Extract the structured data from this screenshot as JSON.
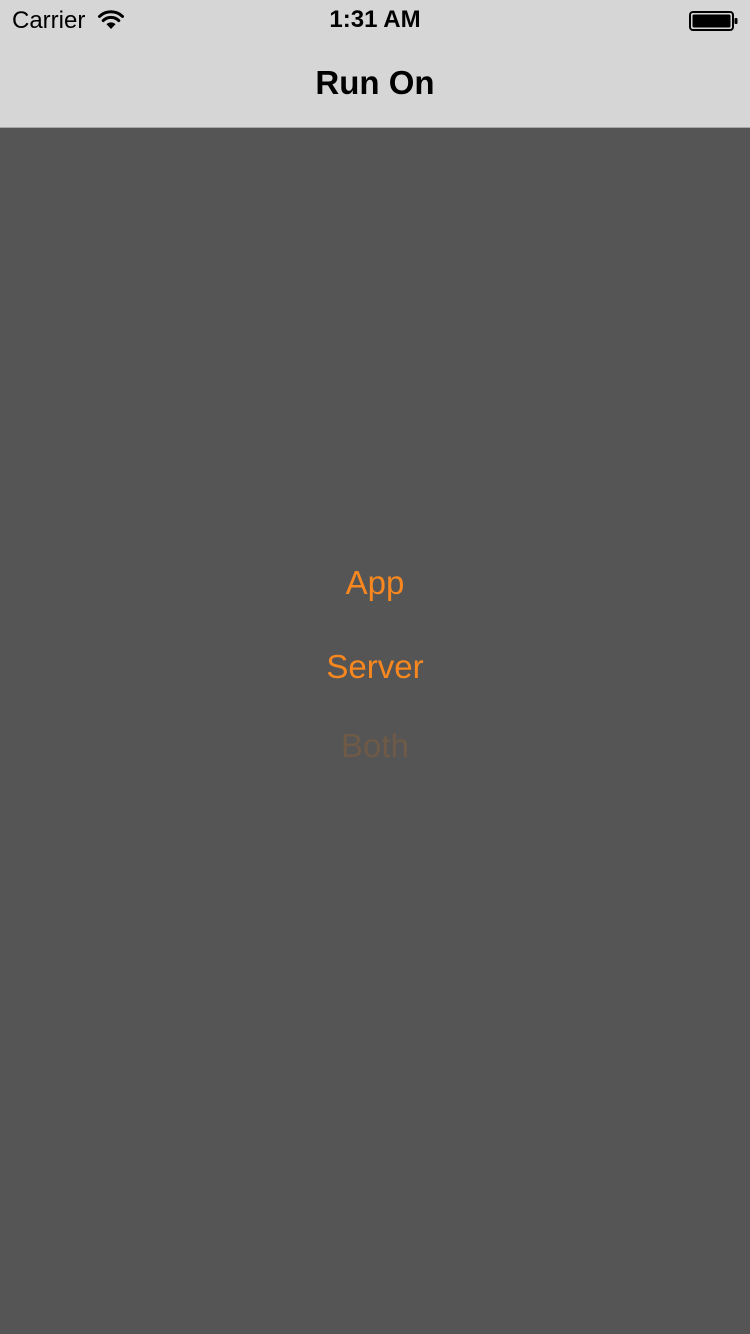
{
  "status_bar": {
    "carrier": "Carrier",
    "time": "1:31 AM",
    "wifi_icon": "wifi-icon",
    "battery_icon": "battery-icon",
    "battery_level": 1.0
  },
  "nav": {
    "title": "Run On"
  },
  "options": [
    {
      "label": "App",
      "enabled": true
    },
    {
      "label": "Server",
      "enabled": true
    },
    {
      "label": "Both",
      "enabled": false
    }
  ],
  "colors": {
    "bar_background": "#d6d6d6",
    "content_background": "#555555",
    "accent": "#f7871e",
    "accent_disabled": "#6e5a47"
  }
}
